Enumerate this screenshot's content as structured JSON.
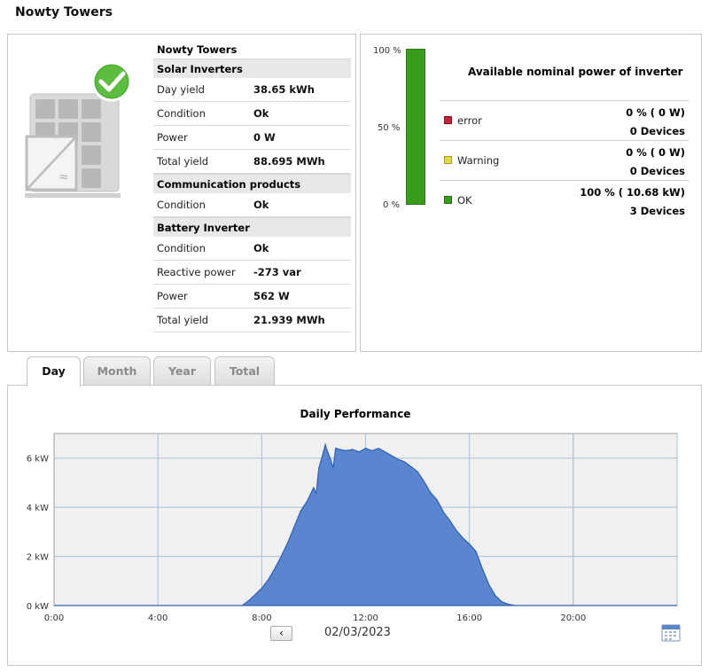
{
  "page": {
    "title": "Nowty Towers"
  },
  "plant_info": {
    "name": "Nowty Towers",
    "sections": [
      {
        "title": "Solar Inverters",
        "rows": [
          {
            "label": "Day yield",
            "value": "38.65 kWh"
          },
          {
            "label": "Condition",
            "value": "Ok"
          },
          {
            "label": "Power",
            "value": "0 W"
          },
          {
            "label": "Total yield",
            "value": "88.695 MWh"
          }
        ]
      },
      {
        "title": "Communication products",
        "rows": [
          {
            "label": "Condition",
            "value": "Ok"
          }
        ]
      },
      {
        "title": "Battery Inverter",
        "rows": [
          {
            "label": "Condition",
            "value": "Ok"
          },
          {
            "label": "Reactive power",
            "value": "-273 var"
          },
          {
            "label": "Power",
            "value": "562 W"
          },
          {
            "label": "Total yield",
            "value": "21.939 MWh"
          }
        ]
      }
    ]
  },
  "nominal_power": {
    "title": "Available nominal power of inverter",
    "bar_labels": {
      "top": "100 %",
      "mid": "50 %",
      "bottom": "0 %"
    },
    "ok_fraction": 1.0,
    "statuses": [
      {
        "name": "error",
        "color": "#cc1f35",
        "percent": "0 %  ( 0 W)",
        "devices": "0 Devices"
      },
      {
        "name": "Warning",
        "color": "#e8d84a",
        "percent": "0 %  ( 0 W)",
        "devices": "0 Devices"
      },
      {
        "name": "OK",
        "color": "#3a9c1c",
        "percent": "100 %  ( 10.68 kW)",
        "devices": "3 Devices"
      }
    ]
  },
  "tabs": [
    {
      "label": "Day",
      "active": true
    },
    {
      "label": "Month",
      "active": false
    },
    {
      "label": "Year",
      "active": false
    },
    {
      "label": "Total",
      "active": false
    }
  ],
  "date_nav": {
    "prev_label": "‹",
    "date": "02/03/2023"
  },
  "chart_data": {
    "type": "area",
    "title": "Daily Performance",
    "xlabel": "",
    "ylabel": "",
    "x_unit": "hours",
    "xlim": [
      0,
      24
    ],
    "ylim": [
      0,
      7
    ],
    "x_ticks": [
      {
        "value": 0,
        "label": "0:00"
      },
      {
        "value": 4,
        "label": "4:00"
      },
      {
        "value": 8,
        "label": "8:00"
      },
      {
        "value": 12,
        "label": "12:00"
      },
      {
        "value": 16,
        "label": "16:00"
      },
      {
        "value": 20,
        "label": "20:00"
      }
    ],
    "y_ticks": [
      {
        "value": 0,
        "label": "0 kW"
      },
      {
        "value": 2,
        "label": "2 kW"
      },
      {
        "value": 4,
        "label": "4 kW"
      },
      {
        "value": 6,
        "label": "6 kW"
      }
    ],
    "grid": true,
    "series": [
      {
        "color": "#5a85cf",
        "x": [
          0,
          7.25,
          7.5,
          7.75,
          8.0,
          8.25,
          8.5,
          8.75,
          9.0,
          9.25,
          9.5,
          9.75,
          10.0,
          10.1,
          10.2,
          10.3,
          10.45,
          10.5,
          10.65,
          10.75,
          10.85,
          11.0,
          11.25,
          11.5,
          11.75,
          12.0,
          12.25,
          12.5,
          12.75,
          13.0,
          13.25,
          13.5,
          13.75,
          14.0,
          14.25,
          14.5,
          14.75,
          15.0,
          15.25,
          15.5,
          15.75,
          16.0,
          16.25,
          16.5,
          16.75,
          17.0,
          17.25,
          17.5,
          17.75,
          24
        ],
        "y": [
          0,
          0,
          0.2,
          0.45,
          0.7,
          1.05,
          1.5,
          2.0,
          2.55,
          3.2,
          3.85,
          4.25,
          4.8,
          4.55,
          5.6,
          5.95,
          6.55,
          6.35,
          5.95,
          5.6,
          6.4,
          6.35,
          6.3,
          6.35,
          6.25,
          6.4,
          6.3,
          6.4,
          6.25,
          6.1,
          5.95,
          5.85,
          5.65,
          5.45,
          5.05,
          4.6,
          4.3,
          3.8,
          3.45,
          3.05,
          2.75,
          2.5,
          2.2,
          1.5,
          0.85,
          0.4,
          0.15,
          0.05,
          0,
          0
        ]
      }
    ]
  }
}
